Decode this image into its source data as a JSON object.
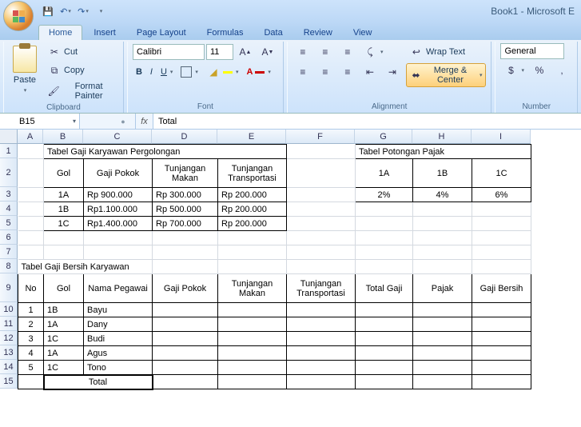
{
  "app": {
    "title": "Book1 - Microsoft E"
  },
  "qat": {
    "save": "save-icon",
    "undo": "undo-icon",
    "redo": "redo-icon"
  },
  "tabs": [
    "Home",
    "Insert",
    "Page Layout",
    "Formulas",
    "Data",
    "Review",
    "View"
  ],
  "activeTab": "Home",
  "ribbon": {
    "clipboard": {
      "label": "Clipboard",
      "paste": "Paste",
      "cut": "Cut",
      "copy": "Copy",
      "fp": "Format Painter"
    },
    "font": {
      "label": "Font",
      "name": "Calibri",
      "size": "11"
    },
    "alignment": {
      "label": "Alignment",
      "wrap": "Wrap Text",
      "merge": "Merge & Center"
    },
    "number": {
      "label": "Number",
      "fmt": "General"
    }
  },
  "namebox": "B15",
  "formula": "Total",
  "cols": [
    "A",
    "B",
    "C",
    "D",
    "E",
    "F",
    "G",
    "H",
    "I"
  ],
  "rows": [
    "1",
    "2",
    "3",
    "4",
    "5",
    "6",
    "7",
    "8",
    "9",
    "10",
    "11",
    "12",
    "13",
    "14",
    "15"
  ],
  "t1": {
    "title": "Tabel Gaji Karyawan Pergolongan",
    "h": [
      "Gol",
      "Gaji Pokok",
      "Tunjangan Makan",
      "Tunjangan Transportasi"
    ],
    "r": [
      [
        "1A",
        "Rp   900.000",
        "Rp  300.000",
        "Rp   200.000"
      ],
      [
        "1B",
        "Rp1.100.000",
        "Rp  500.000",
        "Rp   200.000"
      ],
      [
        "1C",
        "Rp1.400.000",
        "Rp  700.000",
        "Rp   200.000"
      ]
    ]
  },
  "t2": {
    "title": "Tabel Potongan Pajak",
    "h": [
      "1A",
      "1B",
      "1C"
    ],
    "r": [
      "2%",
      "4%",
      "6%"
    ]
  },
  "t3": {
    "title": "Tabel Gaji Bersih Karyawan",
    "h": [
      "No",
      "Gol",
      "Nama Pegawai",
      "Gaji Pokok",
      "Tunjangan Makan",
      "Tunjangan Transportasi",
      "Total Gaji",
      "Pajak",
      "Gaji Bersih"
    ],
    "r": [
      [
        "1",
        "1B",
        "Bayu"
      ],
      [
        "2",
        "1A",
        "Dany"
      ],
      [
        "3",
        "1C",
        "Budi"
      ],
      [
        "4",
        "1A",
        "Agus"
      ],
      [
        "5",
        "1C",
        "Tono"
      ]
    ],
    "total": "Total"
  }
}
